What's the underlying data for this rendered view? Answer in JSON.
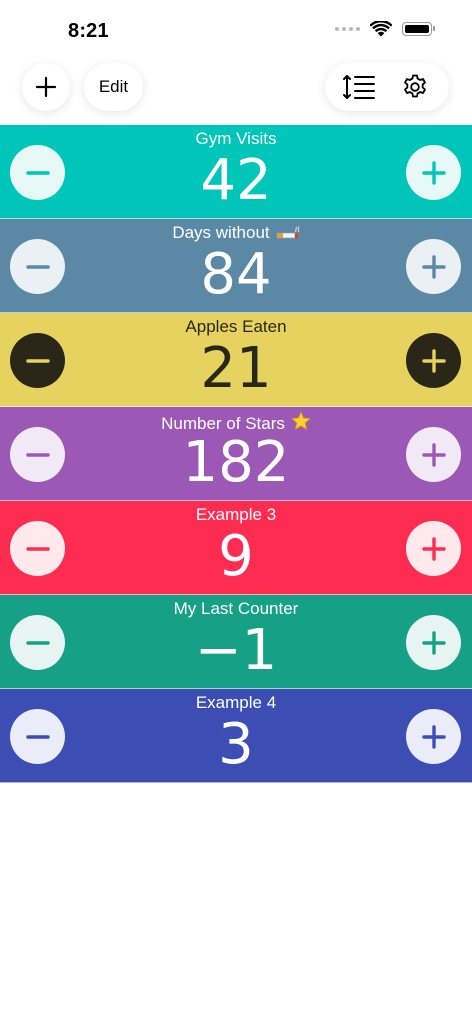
{
  "status_bar": {
    "time": "8:21"
  },
  "toolbar": {
    "add_icon": "plus-icon",
    "edit_label": "Edit",
    "sort_icon": "sort-list-icon",
    "settings_icon": "gear-icon"
  },
  "counters": [
    {
      "title": "Gym Visits",
      "value": "42",
      "bg": "#00C5B9",
      "fg": "#ffffff",
      "btn_bg": "#E7F9F7",
      "btn_fg": "#00C5B9",
      "emoji": ""
    },
    {
      "title": "Days without",
      "value": "84",
      "bg": "#5B88A4",
      "fg": "#ffffff",
      "btn_bg": "#EAF0F4",
      "btn_fg": "#5B88A4",
      "emoji": "cigarette"
    },
    {
      "title": "Apples Eaten",
      "value": "21",
      "bg": "#E6D25F",
      "fg": "#2B2718",
      "btn_bg": "#2B2718",
      "btn_fg": "#E6D25F",
      "emoji": ""
    },
    {
      "title": "Number of Stars",
      "value": "182",
      "bg": "#9B58B5",
      "fg": "#ffffff",
      "btn_bg": "#F1EAF6",
      "btn_fg": "#9B58B5",
      "emoji": "star"
    },
    {
      "title": "Example 3",
      "value": "9",
      "bg": "#FF2C52",
      "fg": "#ffffff",
      "btn_bg": "#FFE9ED",
      "btn_fg": "#FF2C52",
      "emoji": ""
    },
    {
      "title": "My Last Counter",
      "value": "−1",
      "bg": "#16A085",
      "fg": "#ffffff",
      "btn_bg": "#E7F5F2",
      "btn_fg": "#16A085",
      "emoji": ""
    },
    {
      "title": "Example 4",
      "value": "3",
      "bg": "#3C4DB4",
      "fg": "#ffffff",
      "btn_bg": "#EAECF7",
      "btn_fg": "#3C4DB4",
      "emoji": ""
    }
  ]
}
